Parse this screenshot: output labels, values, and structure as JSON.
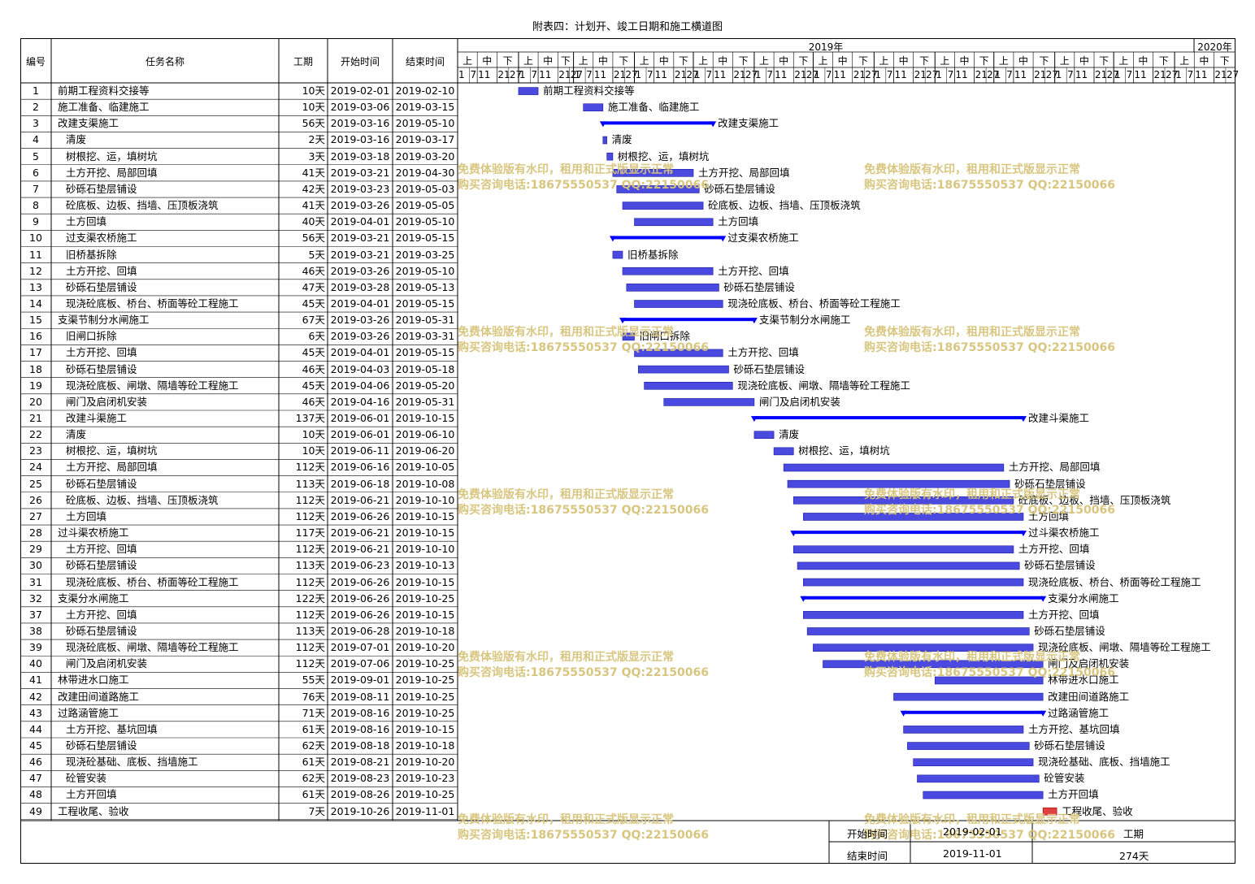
{
  "title": "附表四：计划开、竣工日期和施工横道图",
  "headers": {
    "no": "编号",
    "name": "任务名称",
    "dur": "工期",
    "start": "开始时间",
    "end": "结束时间",
    "year1": "2019年",
    "year2": "2020年"
  },
  "month_parts": [
    "上",
    "中",
    "下"
  ],
  "day_ticks": [
    "1",
    "7",
    "11",
    "21",
    "27"
  ],
  "colors": {
    "bar": "#4a4ae0",
    "summary": "#0000ff",
    "milestone": "#e04040",
    "watermark": "#d6c47a"
  },
  "watermark": {
    "line1": "免费体验版有水印，租用和正式版显示正常",
    "line2": "购买咨询电话:18675550537 QQ:22150066"
  },
  "summary_box": {
    "start_label": "开始时间",
    "start_value": "2019-02-01",
    "end_label": "结束时间",
    "end_value": "2019-11-01",
    "dur_label": "工期",
    "dur_value": "274天"
  },
  "chart_data": {
    "type": "gantt",
    "title": "附表四：计划开、竣工日期和施工横道图",
    "x_range": [
      "2019-01-01",
      "2020-01-31"
    ],
    "tasks": [
      {
        "no": "1",
        "name": "前期工程资料交接等",
        "dur": "10天",
        "start": "2019-02-01",
        "end": "2019-02-10",
        "kind": "task",
        "indent": 0
      },
      {
        "no": "2",
        "name": "施工准备、临建施工",
        "dur": "10天",
        "start": "2019-03-06",
        "end": "2019-03-15",
        "kind": "task",
        "indent": 0
      },
      {
        "no": "3",
        "name": "改建支渠施工",
        "dur": "56天",
        "start": "2019-03-16",
        "end": "2019-05-10",
        "kind": "summary",
        "indent": 0
      },
      {
        "no": "4",
        "name": "清废",
        "dur": "2天",
        "start": "2019-03-16",
        "end": "2019-03-17",
        "kind": "task",
        "indent": 1
      },
      {
        "no": "5",
        "name": "树根挖、运，填树坑",
        "dur": "3天",
        "start": "2019-03-18",
        "end": "2019-03-20",
        "kind": "task",
        "indent": 1
      },
      {
        "no": "6",
        "name": "土方开挖、局部回填",
        "dur": "41天",
        "start": "2019-03-21",
        "end": "2019-04-30",
        "kind": "task",
        "indent": 1
      },
      {
        "no": "7",
        "name": "砂砾石垫层铺设",
        "dur": "42天",
        "start": "2019-03-23",
        "end": "2019-05-03",
        "kind": "task",
        "indent": 1
      },
      {
        "no": "8",
        "name": "砼底板、边板、挡墙、压顶板浇筑",
        "dur": "41天",
        "start": "2019-03-26",
        "end": "2019-05-05",
        "kind": "task",
        "indent": 1
      },
      {
        "no": "9",
        "name": "土方回填",
        "dur": "40天",
        "start": "2019-04-01",
        "end": "2019-05-10",
        "kind": "task",
        "indent": 1
      },
      {
        "no": "10",
        "name": "过支渠农桥施工",
        "dur": "56天",
        "start": "2019-03-21",
        "end": "2019-05-15",
        "kind": "summary",
        "indent": 1
      },
      {
        "no": "11",
        "name": "旧桥基拆除",
        "dur": "5天",
        "start": "2019-03-21",
        "end": "2019-03-25",
        "kind": "task",
        "indent": 1
      },
      {
        "no": "12",
        "name": "土方开挖、回填",
        "dur": "46天",
        "start": "2019-03-26",
        "end": "2019-05-10",
        "kind": "task",
        "indent": 1
      },
      {
        "no": "13",
        "name": "砂砾石垫层铺设",
        "dur": "47天",
        "start": "2019-03-28",
        "end": "2019-05-13",
        "kind": "task",
        "indent": 1
      },
      {
        "no": "14",
        "name": "现浇砼底板、桥台、桥面等砼工程施工",
        "dur": "45天",
        "start": "2019-04-01",
        "end": "2019-05-15",
        "kind": "task",
        "indent": 1
      },
      {
        "no": "15",
        "name": "支渠节制分水闸施工",
        "dur": "67天",
        "start": "2019-03-26",
        "end": "2019-05-31",
        "kind": "summary",
        "indent": 0
      },
      {
        "no": "16",
        "name": "旧闸口拆除",
        "dur": "6天",
        "start": "2019-03-26",
        "end": "2019-03-31",
        "kind": "task",
        "indent": 1
      },
      {
        "no": "17",
        "name": "土方开挖、回填",
        "dur": "45天",
        "start": "2019-04-01",
        "end": "2019-05-15",
        "kind": "task",
        "indent": 1
      },
      {
        "no": "18",
        "name": "砂砾石垫层铺设",
        "dur": "46天",
        "start": "2019-04-03",
        "end": "2019-05-18",
        "kind": "task",
        "indent": 1
      },
      {
        "no": "19",
        "name": "现浇砼底板、闸墩、隔墙等砼工程施工",
        "dur": "45天",
        "start": "2019-04-06",
        "end": "2019-05-20",
        "kind": "task",
        "indent": 1
      },
      {
        "no": "20",
        "name": "闸门及启闭机安装",
        "dur": "46天",
        "start": "2019-04-16",
        "end": "2019-05-31",
        "kind": "task",
        "indent": 1
      },
      {
        "no": "21",
        "name": "改建斗渠施工",
        "dur": "137天",
        "start": "2019-06-01",
        "end": "2019-10-15",
        "kind": "summary",
        "indent": 1
      },
      {
        "no": "22",
        "name": "清废",
        "dur": "10天",
        "start": "2019-06-01",
        "end": "2019-06-10",
        "kind": "task",
        "indent": 1
      },
      {
        "no": "23",
        "name": "树根挖、运，填树坑",
        "dur": "10天",
        "start": "2019-06-11",
        "end": "2019-06-20",
        "kind": "task",
        "indent": 1
      },
      {
        "no": "24",
        "name": "土方开挖、局部回填",
        "dur": "112天",
        "start": "2019-06-16",
        "end": "2019-10-05",
        "kind": "task",
        "indent": 1
      },
      {
        "no": "25",
        "name": "砂砾石垫层铺设",
        "dur": "113天",
        "start": "2019-06-18",
        "end": "2019-10-08",
        "kind": "task",
        "indent": 1
      },
      {
        "no": "26",
        "name": "砼底板、边板、挡墙、压顶板浇筑",
        "dur": "112天",
        "start": "2019-06-21",
        "end": "2019-10-10",
        "kind": "task",
        "indent": 1
      },
      {
        "no": "27",
        "name": "土方回填",
        "dur": "112天",
        "start": "2019-06-26",
        "end": "2019-10-15",
        "kind": "task",
        "indent": 1
      },
      {
        "no": "28",
        "name": "过斗渠农桥施工",
        "dur": "117天",
        "start": "2019-06-21",
        "end": "2019-10-15",
        "kind": "summary",
        "indent": 0
      },
      {
        "no": "29",
        "name": "土方开挖、回填",
        "dur": "112天",
        "start": "2019-06-21",
        "end": "2019-10-10",
        "kind": "task",
        "indent": 1
      },
      {
        "no": "30",
        "name": "砂砾石垫层铺设",
        "dur": "113天",
        "start": "2019-06-23",
        "end": "2019-10-13",
        "kind": "task",
        "indent": 1
      },
      {
        "no": "31",
        "name": "现浇砼底板、桥台、桥面等砼工程施工",
        "dur": "112天",
        "start": "2019-06-26",
        "end": "2019-10-15",
        "kind": "task",
        "indent": 1
      },
      {
        "no": "32",
        "name": "支渠分水闸施工",
        "dur": "122天",
        "start": "2019-06-26",
        "end": "2019-10-25",
        "kind": "summary",
        "indent": 0
      },
      {
        "no": "37",
        "name": "土方开挖、回填",
        "dur": "112天",
        "start": "2019-06-26",
        "end": "2019-10-15",
        "kind": "task",
        "indent": 1
      },
      {
        "no": "38",
        "name": "砂砾石垫层铺设",
        "dur": "113天",
        "start": "2019-06-28",
        "end": "2019-10-18",
        "kind": "task",
        "indent": 1
      },
      {
        "no": "39",
        "name": "现浇砼底板、闸墩、隔墙等砼工程施工",
        "dur": "112天",
        "start": "2019-07-01",
        "end": "2019-10-20",
        "kind": "task",
        "indent": 1
      },
      {
        "no": "40",
        "name": "闸门及启闭机安装",
        "dur": "112天",
        "start": "2019-07-06",
        "end": "2019-10-25",
        "kind": "task",
        "indent": 1
      },
      {
        "no": "41",
        "name": "林带进水口施工",
        "dur": "55天",
        "start": "2019-09-01",
        "end": "2019-10-25",
        "kind": "task",
        "indent": 0
      },
      {
        "no": "42",
        "name": "改建田间道路施工",
        "dur": "76天",
        "start": "2019-08-11",
        "end": "2019-10-25",
        "kind": "task",
        "indent": 0
      },
      {
        "no": "43",
        "name": "过路涵管施工",
        "dur": "71天",
        "start": "2019-08-16",
        "end": "2019-10-25",
        "kind": "summary",
        "indent": 0
      },
      {
        "no": "44",
        "name": "土方开挖、基坑回填",
        "dur": "61天",
        "start": "2019-08-16",
        "end": "2019-10-15",
        "kind": "task",
        "indent": 1
      },
      {
        "no": "45",
        "name": "砂砾石垫层铺设",
        "dur": "62天",
        "start": "2019-08-18",
        "end": "2019-10-18",
        "kind": "task",
        "indent": 1
      },
      {
        "no": "46",
        "name": "现浇砼基础、底板、挡墙施工",
        "dur": "61天",
        "start": "2019-08-21",
        "end": "2019-10-20",
        "kind": "task",
        "indent": 1
      },
      {
        "no": "47",
        "name": "砼管安装",
        "dur": "62天",
        "start": "2019-08-23",
        "end": "2019-10-23",
        "kind": "task",
        "indent": 1
      },
      {
        "no": "48",
        "name": "土方开回填",
        "dur": "61天",
        "start": "2019-08-26",
        "end": "2019-10-25",
        "kind": "task",
        "indent": 1
      },
      {
        "no": "49",
        "name": "工程收尾、验收",
        "dur": "7天",
        "start": "2019-10-26",
        "end": "2019-11-01",
        "kind": "milestone",
        "indent": 0
      }
    ]
  }
}
